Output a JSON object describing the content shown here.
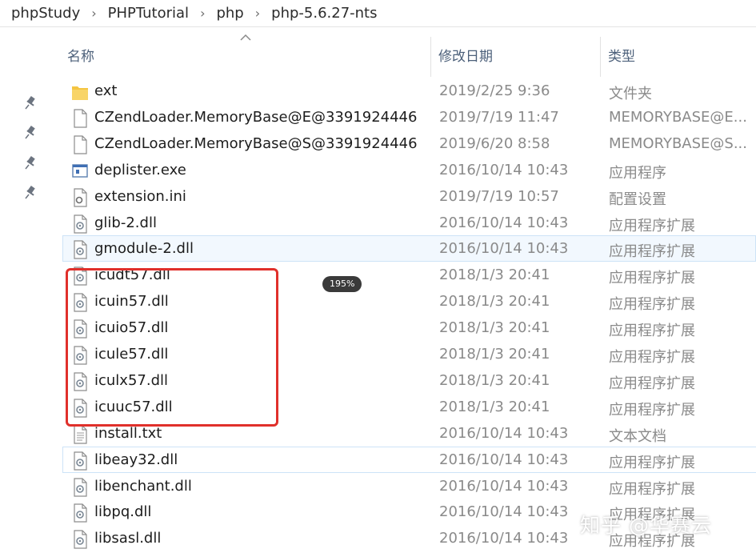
{
  "breadcrumb": [
    "phpStudy",
    "PHPTutorial",
    "php",
    "php-5.6.27-nts"
  ],
  "columns": {
    "name": "名称",
    "date": "修改日期",
    "type": "类型"
  },
  "files": [
    {
      "name": "ext",
      "date": "2019/2/25 9:36",
      "type": "文件夹",
      "icon": "folder-icon"
    },
    {
      "name": "CZendLoader.MemoryBase@E@3391924446",
      "date": "2019/7/19 11:47",
      "type": "MEMORYBASE@E...",
      "icon": "file-icon"
    },
    {
      "name": "CZendLoader.MemoryBase@S@3391924446",
      "date": "2019/6/20 8:58",
      "type": "MEMORYBASE@S...",
      "icon": "file-icon"
    },
    {
      "name": "deplister.exe",
      "date": "2016/10/14 10:43",
      "type": "应用程序",
      "icon": "exe-icon"
    },
    {
      "name": "extension.ini",
      "date": "2019/7/19 10:57",
      "type": "配置设置",
      "icon": "ini-icon"
    },
    {
      "name": "glib-2.dll",
      "date": "2016/10/14 10:43",
      "type": "应用程序扩展",
      "icon": "dll-icon"
    },
    {
      "name": "gmodule-2.dll",
      "date": "2016/10/14 10:43",
      "type": "应用程序扩展",
      "icon": "dll-icon"
    },
    {
      "name": "icudt57.dll",
      "date": "2018/1/3 20:41",
      "type": "应用程序扩展",
      "icon": "dll-icon"
    },
    {
      "name": "icuin57.dll",
      "date": "2018/1/3 20:41",
      "type": "应用程序扩展",
      "icon": "dll-icon"
    },
    {
      "name": "icuio57.dll",
      "date": "2018/1/3 20:41",
      "type": "应用程序扩展",
      "icon": "dll-icon"
    },
    {
      "name": "icule57.dll",
      "date": "2018/1/3 20:41",
      "type": "应用程序扩展",
      "icon": "dll-icon"
    },
    {
      "name": "iculx57.dll",
      "date": "2018/1/3 20:41",
      "type": "应用程序扩展",
      "icon": "dll-icon"
    },
    {
      "name": "icuuc57.dll",
      "date": "2018/1/3 20:41",
      "type": "应用程序扩展",
      "icon": "dll-icon"
    },
    {
      "name": "install.txt",
      "date": "2016/10/14 10:43",
      "type": "文本文档",
      "icon": "txt-icon"
    },
    {
      "name": "libeay32.dll",
      "date": "2016/10/14 10:43",
      "type": "应用程序扩展",
      "icon": "dll-icon"
    },
    {
      "name": "libenchant.dll",
      "date": "2016/10/14 10:43",
      "type": "应用程序扩展",
      "icon": "dll-icon"
    },
    {
      "name": "libpq.dll",
      "date": "2016/10/14 10:43",
      "type": "应用程序扩展",
      "icon": "dll-icon"
    },
    {
      "name": "libsasl.dll",
      "date": "2016/10/14 10:43",
      "type": "应用程序扩展",
      "icon": "dll-icon"
    }
  ],
  "selected_file": "gmodule-2.dll",
  "hovered_file": "libeay32.dll",
  "highlighted_files": [
    "icudt57.dll",
    "icuin57.dll",
    "icuio57.dll",
    "icule57.dll",
    "iculx57.dll",
    "icuuc57.dll"
  ],
  "zoom_badge": "195%",
  "watermark": "知乎 @华赛云",
  "colors": {
    "highlight_border": "#e0302b",
    "selection_bg": "#f2f8fe",
    "folder": "#f5c542"
  }
}
